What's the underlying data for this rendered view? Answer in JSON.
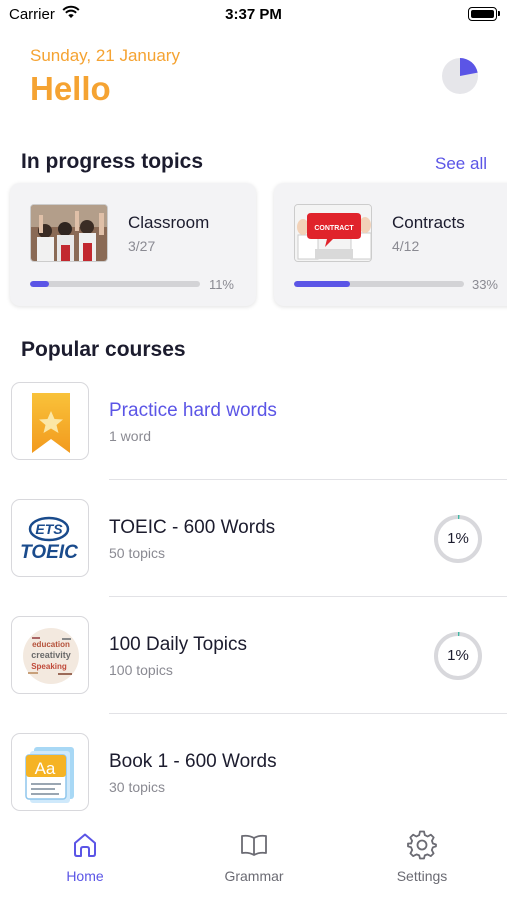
{
  "status_bar": {
    "carrier": "Carrier",
    "time": "3:37 PM"
  },
  "header": {
    "date": "Sunday, 21 January",
    "greeting": "Hello",
    "overall_progress_fraction": 0.22
  },
  "in_progress": {
    "title": "In progress topics",
    "see_all": "See all",
    "topics": [
      {
        "title": "Classroom",
        "count": "3/27",
        "percent_label": "11%",
        "progress": 0.11
      },
      {
        "title": "Contracts",
        "count": "4/12",
        "percent_label": "33%",
        "progress": 0.33,
        "thumb_text": "CONTRACT"
      }
    ]
  },
  "popular": {
    "title": "Popular courses",
    "courses": [
      {
        "title": "Practice hard words",
        "subtitle": "1 word",
        "icon": "bookmark-star-icon"
      },
      {
        "title": "TOEIC - 600 Words",
        "subtitle": "50 topics",
        "progress_label": "1%",
        "progress": 0.01,
        "icon": "ets-toeic-logo",
        "logo_top": "ETS",
        "logo_bottom": "TOEIC"
      },
      {
        "title": "100 Daily Topics",
        "subtitle": "100 topics",
        "progress_label": "1%",
        "progress": 0.01,
        "icon": "word-cloud-icon",
        "cloud_words": [
          "education",
          "creativity",
          "Speaking"
        ]
      },
      {
        "title": "Book 1 - 600 Words",
        "subtitle": "30 topics",
        "icon": "book-aa-icon",
        "book_letters": "Aa"
      }
    ]
  },
  "tab_bar": {
    "tabs": [
      {
        "label": "Home",
        "icon": "home-icon",
        "active": true
      },
      {
        "label": "Grammar",
        "icon": "book-open-icon",
        "active": false
      },
      {
        "label": "Settings",
        "icon": "gear-icon",
        "active": false
      }
    ]
  },
  "colors": {
    "accent": "#5b55e6",
    "orange": "#f5a332",
    "muted": "#8a8a92",
    "ring_track": "#d8d8dc",
    "ring_progress": "#3fb8a4"
  }
}
